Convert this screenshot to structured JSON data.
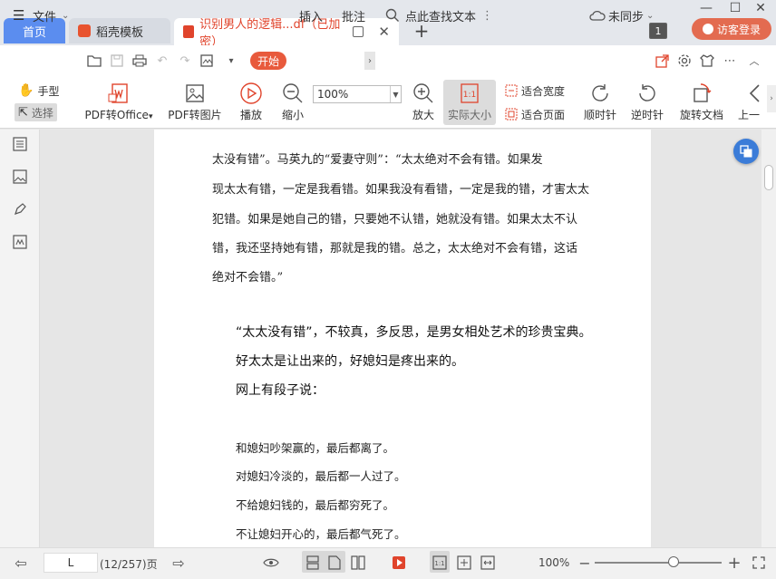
{
  "tabs": {
    "home": "首页",
    "template": "稻壳模板",
    "document": "识别男人的逻辑...df（已加密）"
  },
  "title_bar": {
    "page_count_badge": "1",
    "login_label": "访客登录"
  },
  "menu": {
    "file": "文件",
    "start": "开始",
    "insert": "插入",
    "annotate": "批注",
    "search": "点此查找文本",
    "sync": "未同步"
  },
  "ribbon": {
    "hand": "手型",
    "select": "选择",
    "pdf_to_office": "PDF转Office",
    "pdf_to_image": "PDF转图片",
    "play": "播放",
    "zoom_out": "缩小",
    "zoom_value": "100%",
    "zoom_in": "放大",
    "actual_size": "实际大小",
    "fit_width": "适合宽度",
    "fit_page": "适合页面",
    "rotate_cw": "顺时针",
    "rotate_ccw": "逆时针",
    "rotate_doc": "旋转文档",
    "prev": "上一"
  },
  "document": {
    "para1": [
      "太没有错”。马英九的“爱妻守则”：“太太绝对不会有错。如果发",
      "现太太有错，一定是我看错。如果我没有看错，一定是我的错，才害太太",
      "犯错。如果是她自己的错，只要她不认错，她就没有错。如果太太不认",
      "错，我还坚持她有错，那就是我的错。总之，太太绝对不会有错，这话",
      "绝对不会错。”"
    ],
    "para2": [
      "“太太没有错”，不较真，多反思，是男女相处艺术的珍贵宝典。",
      "好太太是让出来的，好媳妇是疼出来的。",
      "网上有段子说："
    ],
    "para3": [
      "和媳妇吵架赢的，最后都离了。",
      "对媳妇冷淡的，最后都一人过了。",
      "不给媳妇钱的，最后都穷死了。",
      "不让媳妇开心的，最后都气死了。"
    ]
  },
  "status": {
    "page_input": "L",
    "page_info": "(12/257)页",
    "zoom_percent": "100%"
  }
}
